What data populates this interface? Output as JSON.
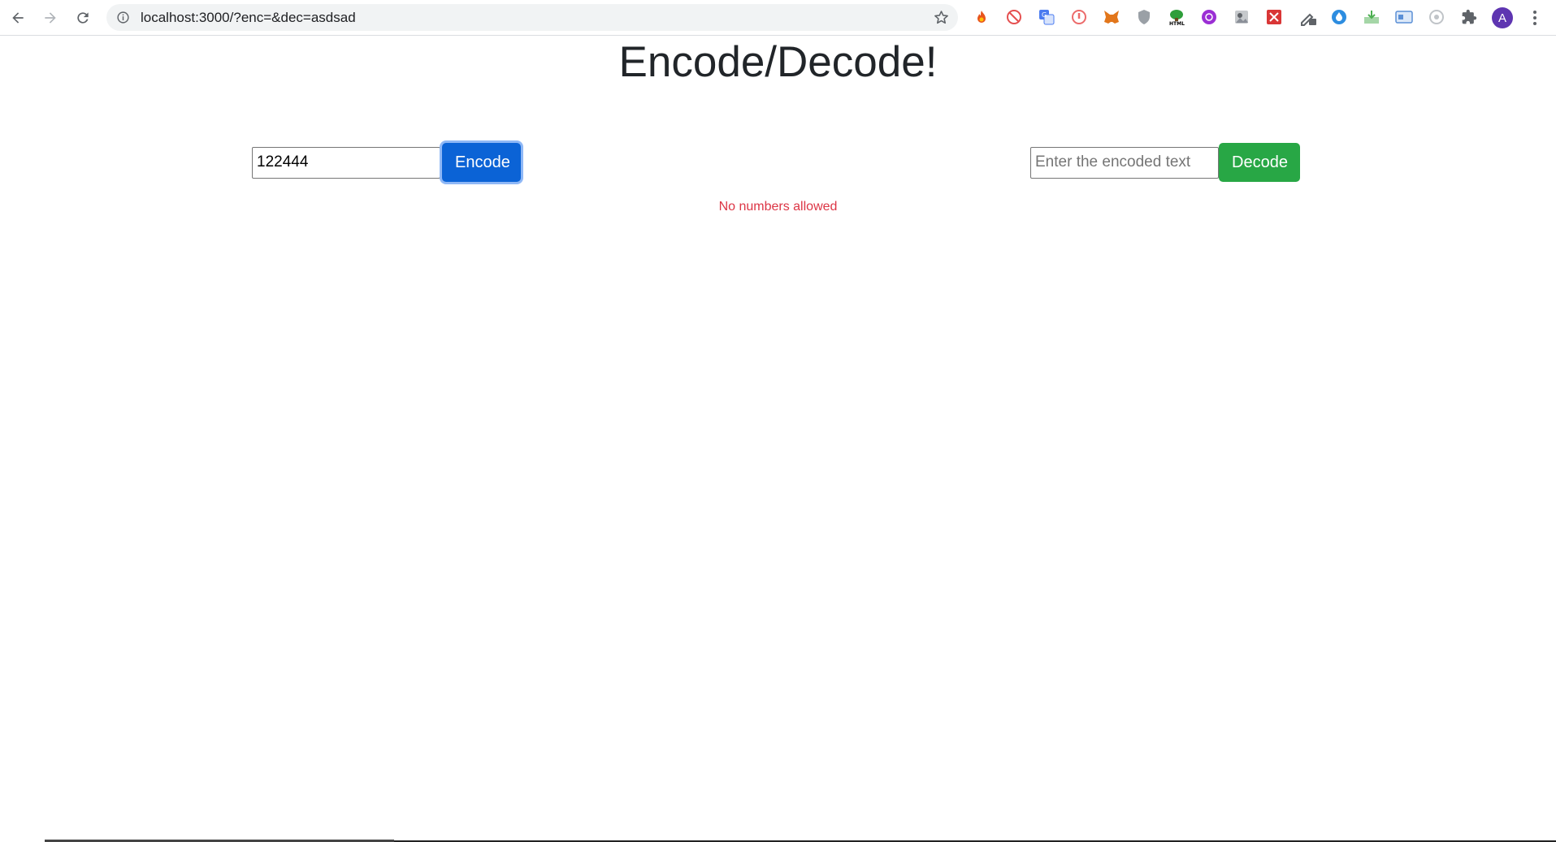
{
  "browser": {
    "url": "localhost:3000/?enc=&dec=asdsad",
    "avatar_letter": "A",
    "extensions": [
      {
        "name": "fire-extension-icon",
        "color": "#e8541c"
      },
      {
        "name": "blocker-extension-icon",
        "color": "#e55050"
      },
      {
        "name": "translate-extension-icon",
        "color": "#4a7bf0"
      },
      {
        "name": "red-circle-extension-icon",
        "color": "#ec6b6b"
      },
      {
        "name": "metamask-extension-icon",
        "color": "#e2761b"
      },
      {
        "name": "shield-extension-icon",
        "color": "#8a8f98"
      },
      {
        "name": "html-extension-icon",
        "color": "#2e9e3a"
      },
      {
        "name": "purple-extension-icon",
        "color": "#9b2fd4"
      },
      {
        "name": "photo-extension-icon",
        "color": "#8a8f98"
      },
      {
        "name": "red-box-extension-icon",
        "color": "#d93636"
      },
      {
        "name": "eyedropper-extension-icon",
        "color": "#5f6368"
      },
      {
        "name": "droplet-extension-icon",
        "color": "#2d8de0"
      },
      {
        "name": "download-extension-icon",
        "color": "#4caf50"
      },
      {
        "name": "window-extension-icon",
        "color": "#5b8fd6"
      },
      {
        "name": "circle-extension-icon",
        "color": "#b0b4ba"
      },
      {
        "name": "puzzle-extensions-icon",
        "color": "#5f6368"
      }
    ]
  },
  "page": {
    "title": "Encode/Decode!",
    "encode": {
      "value": "122444",
      "button_label": "Encode"
    },
    "decode": {
      "value": "",
      "placeholder": "Enter the encoded text",
      "button_label": "Decode"
    },
    "error": "No numbers allowed"
  },
  "colors": {
    "primary": "#0b63d6",
    "success": "#28a745",
    "error": "#dc3545"
  }
}
